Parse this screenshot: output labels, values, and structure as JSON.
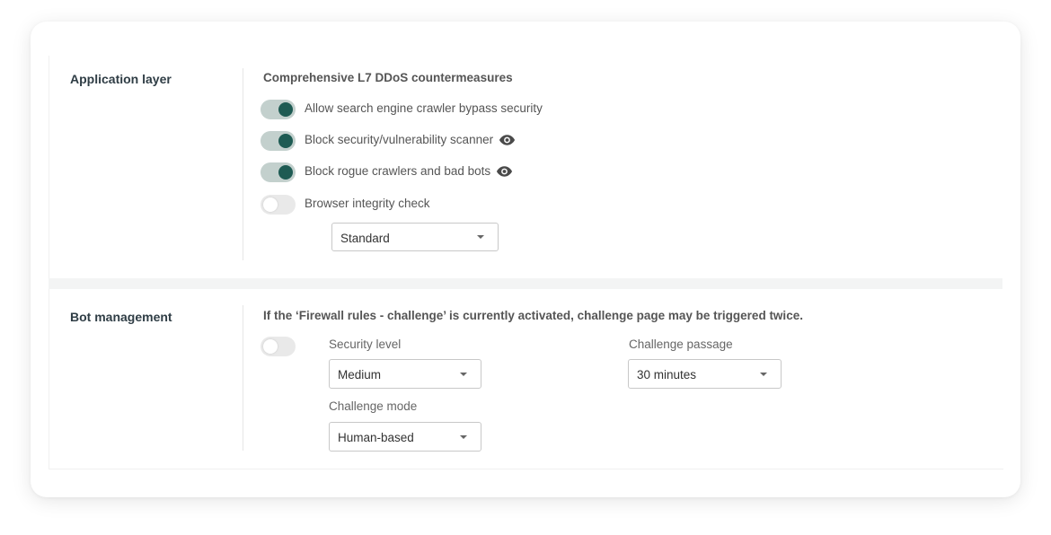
{
  "application_layer": {
    "title": "Application layer",
    "heading": "Comprehensive L7 DDoS countermeasures",
    "options": [
      {
        "label": "Allow search engine crawler bypass security",
        "enabled": true,
        "has_eye_icon": false
      },
      {
        "label": "Block security/vulnerability scanner",
        "enabled": true,
        "has_eye_icon": true
      },
      {
        "label": "Block rogue crawlers and bad bots",
        "enabled": true,
        "has_eye_icon": true
      },
      {
        "label": "Browser integrity check",
        "enabled": false,
        "has_eye_icon": false
      }
    ],
    "integrity_select": {
      "value": "Standard"
    }
  },
  "bot_management": {
    "title": "Bot management",
    "notice": "If the ‘Firewall rules - challenge’ is currently activated, challenge page may be triggered twice.",
    "enabled": false,
    "security_level": {
      "label": "Security level",
      "value": "Medium"
    },
    "challenge_passage": {
      "label": "Challenge passage",
      "value": "30 minutes"
    },
    "challenge_mode": {
      "label": "Challenge mode",
      "value": "Human-based"
    }
  },
  "colors": {
    "toggle_on_track": "#c3d0cd",
    "toggle_on_knob": "#1e5b53",
    "toggle_off_track": "#e9e9e9",
    "title_text": "#2f3d45"
  },
  "icons": [
    "eye-icon",
    "chevron-down-icon"
  ]
}
